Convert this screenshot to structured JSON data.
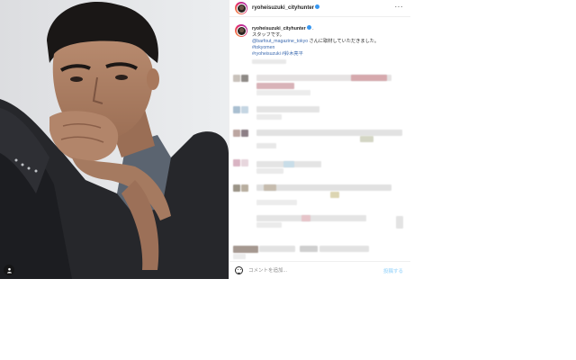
{
  "post": {
    "username": "ryoheisuzuki_cityhunter",
    "more_label": "···",
    "caption": {
      "username": "ryoheisuzuki_cityhunter",
      "dot": ".",
      "line1": "スタッフです。",
      "mention": "@barfout_magazine_tokyo",
      "line2_suffix": " さんに取材していただきました。",
      "hashtag1": "#tokyomen",
      "hashtag2": "#ryoheisuzuki #鈴木亮平"
    },
    "comment_placeholder": "コメントを追加...",
    "post_button": "投稿する"
  },
  "icons": {
    "verified": "verified-badge-icon",
    "more": "more-options-icon",
    "emoji": "emoji-icon",
    "tag": "user-tag-icon"
  },
  "colors": {
    "link": "#3d6bb0",
    "verified": "#3897f0",
    "post_button_disabled": "#b2dffc",
    "border": "#efefef"
  }
}
